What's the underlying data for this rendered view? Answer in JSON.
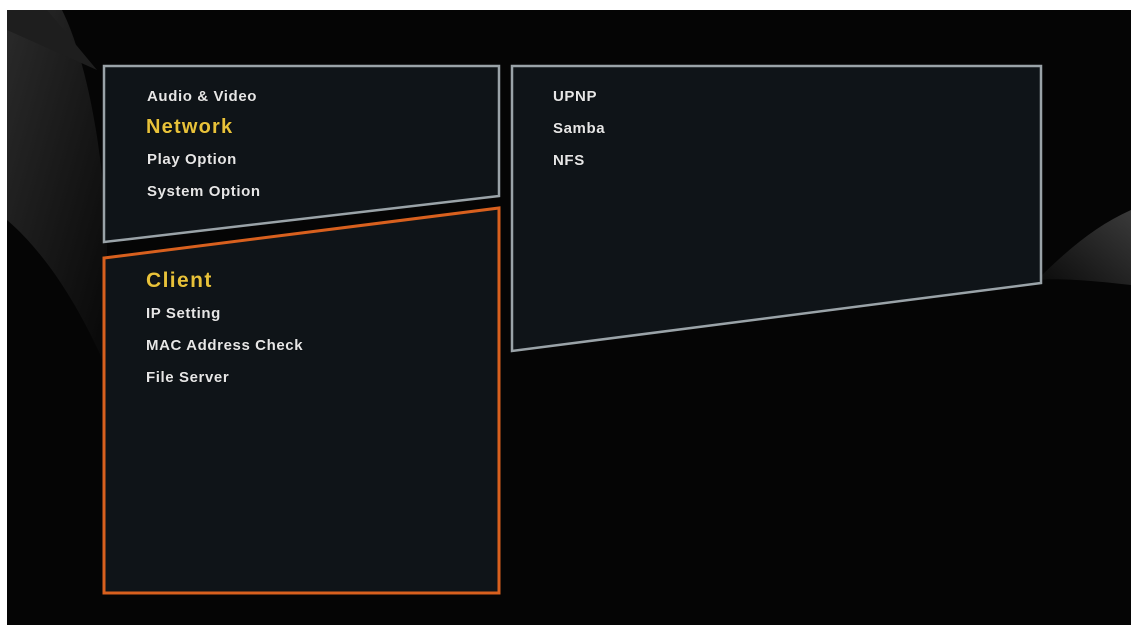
{
  "colors": {
    "background": "#050505",
    "panel_fill": "#0f1418",
    "panel_border": "#9aa3a8",
    "focus_border": "#d8601e",
    "active_text": "#e8c23a",
    "text": "#e6e6e6"
  },
  "main_menu": {
    "items": [
      {
        "label": "Audio & Video",
        "active": false
      },
      {
        "label": "Network",
        "active": true
      },
      {
        "label": "Play Option",
        "active": false
      },
      {
        "label": "System Option",
        "active": false
      }
    ]
  },
  "sub_menu": {
    "items": [
      {
        "label": "Client",
        "active": true
      },
      {
        "label": "IP Setting",
        "active": false
      },
      {
        "label": "MAC Address Check",
        "active": false
      },
      {
        "label": "File Server",
        "active": false
      }
    ]
  },
  "options_menu": {
    "items": [
      {
        "label": "UPNP"
      },
      {
        "label": "Samba"
      },
      {
        "label": "NFS"
      }
    ]
  }
}
